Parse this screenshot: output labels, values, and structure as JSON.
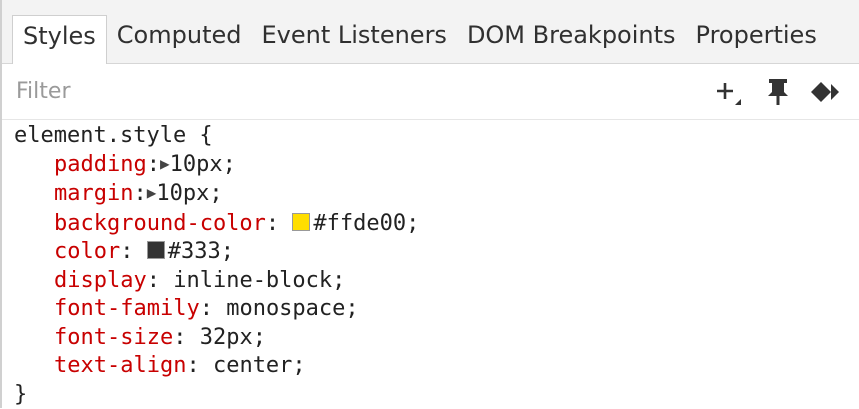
{
  "tabs": [
    {
      "label": "Styles",
      "active": true
    },
    {
      "label": "Computed",
      "active": false
    },
    {
      "label": "Event Listeners",
      "active": false
    },
    {
      "label": "DOM Breakpoints",
      "active": false
    },
    {
      "label": "Properties",
      "active": false
    }
  ],
  "filter": {
    "placeholder": "Filter",
    "value": ""
  },
  "toolbar": {
    "icons": [
      "new-style-rule-icon",
      "pin-icon",
      "element-state-icon"
    ]
  },
  "rule": {
    "selector": "element.style {",
    "close": "}",
    "declarations": [
      {
        "prop": "padding",
        "sep": ":",
        "value": "10px;",
        "expander": "▶"
      },
      {
        "prop": "margin",
        "sep": ":",
        "value": "10px;",
        "expander": "▶"
      },
      {
        "prop": "background-color",
        "sep": ": ",
        "value": "#ffde00;",
        "swatch": "#ffde00"
      },
      {
        "prop": "color",
        "sep": ": ",
        "value": "#333;",
        "swatch": "#333333"
      },
      {
        "prop": "display",
        "sep": ": ",
        "value": "inline-block;"
      },
      {
        "prop": "font-family",
        "sep": ": ",
        "value": "monospace;"
      },
      {
        "prop": "font-size",
        "sep": ": ",
        "value": "32px;"
      },
      {
        "prop": "text-align",
        "sep": ": ",
        "value": "center;"
      }
    ]
  },
  "colors": {
    "property_name": "#c80000",
    "swatch_yellow": "#ffde00",
    "swatch_dark": "#333333"
  }
}
